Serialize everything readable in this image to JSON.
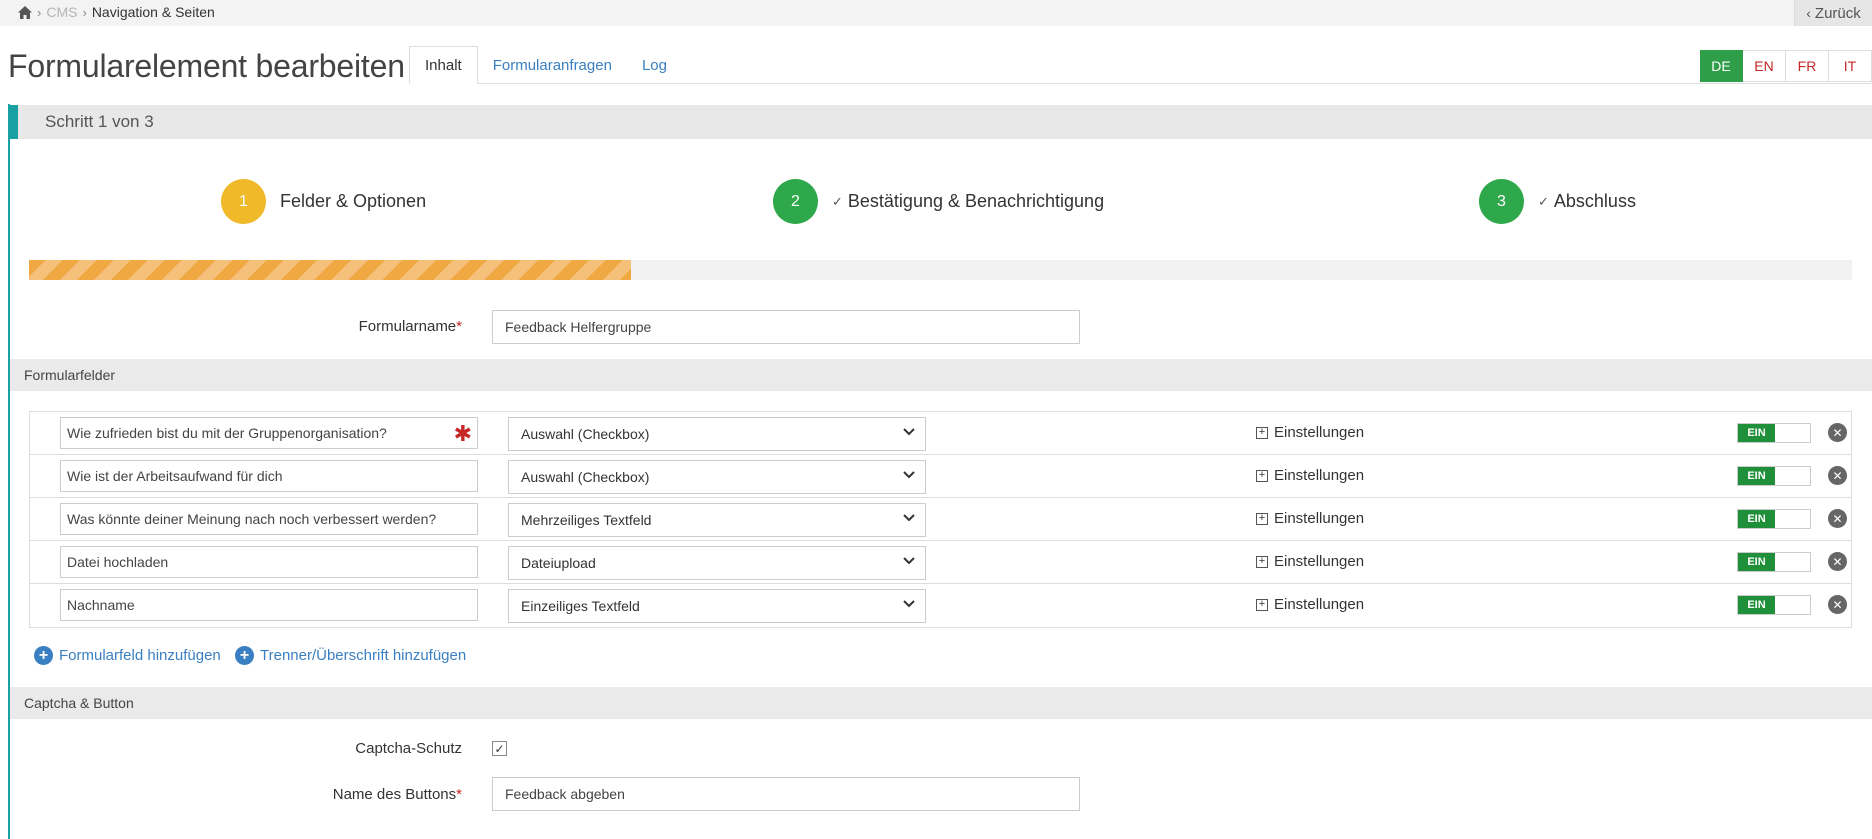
{
  "breadcrumb": {
    "items": [
      "CMS",
      "Navigation & Seiten"
    ]
  },
  "back_label": "Zurück",
  "page_title": "Formularelement bearbeiten",
  "tabs": [
    {
      "label": "Inhalt",
      "active": true
    },
    {
      "label": "Formularanfragen",
      "active": false
    },
    {
      "label": "Log",
      "active": false
    }
  ],
  "languages": [
    {
      "code": "DE",
      "active": true
    },
    {
      "code": "EN",
      "active": false
    },
    {
      "code": "FR",
      "active": false
    },
    {
      "code": "IT",
      "active": false
    }
  ],
  "step_header": "Schritt 1 von 3",
  "steps": [
    {
      "number": "1",
      "label": "Felder & Optionen",
      "color": "#f0b92a",
      "done": false
    },
    {
      "number": "2",
      "label": "Bestätigung & Benachrichtigung",
      "color": "#2ea84a",
      "done": true
    },
    {
      "number": "3",
      "label": "Abschluss",
      "color": "#2ea84a",
      "done": true
    }
  ],
  "progress": 0.33,
  "form_name": {
    "label": "Formularname",
    "required": "*",
    "value": "Feedback Helfergruppe"
  },
  "sections": {
    "fields": "Formularfelder",
    "captcha": "Captcha & Button"
  },
  "fields": [
    {
      "name": "Wie zufrieden bist du mit der Gruppenorganisation?",
      "type": "Auswahl (Checkbox)",
      "required": true,
      "settings": "Einstellungen",
      "toggle": "EIN"
    },
    {
      "name": "Wie ist der Arbeitsaufwand für dich",
      "type": "Auswahl (Checkbox)",
      "required": false,
      "settings": "Einstellungen",
      "toggle": "EIN"
    },
    {
      "name": "Was könnte deiner Meinung nach noch verbessert werden?",
      "type": "Mehrzeiliges Textfeld",
      "required": false,
      "settings": "Einstellungen",
      "toggle": "EIN"
    },
    {
      "name": "Datei hochladen",
      "type": "Dateiupload",
      "required": false,
      "settings": "Einstellungen",
      "toggle": "EIN"
    },
    {
      "name": "Nachname",
      "type": "Einzeiliges Textfeld",
      "required": false,
      "settings": "Einstellungen",
      "toggle": "EIN"
    }
  ],
  "add_field_label": "Formularfeld hinzufügen",
  "add_divider_label": "Trenner/Überschrift hinzufügen",
  "captcha": {
    "label": "Captcha-Schutz",
    "checked": true
  },
  "button_name": {
    "label": "Name des Buttons",
    "required": "*",
    "value": "Feedback abgeben"
  },
  "colors": {
    "accent_teal": "#19a0a3",
    "link_blue": "#3a7fc1",
    "active_green": "#2e9e48",
    "required_red": "#c62828",
    "progress_orange": "#f0a843"
  }
}
